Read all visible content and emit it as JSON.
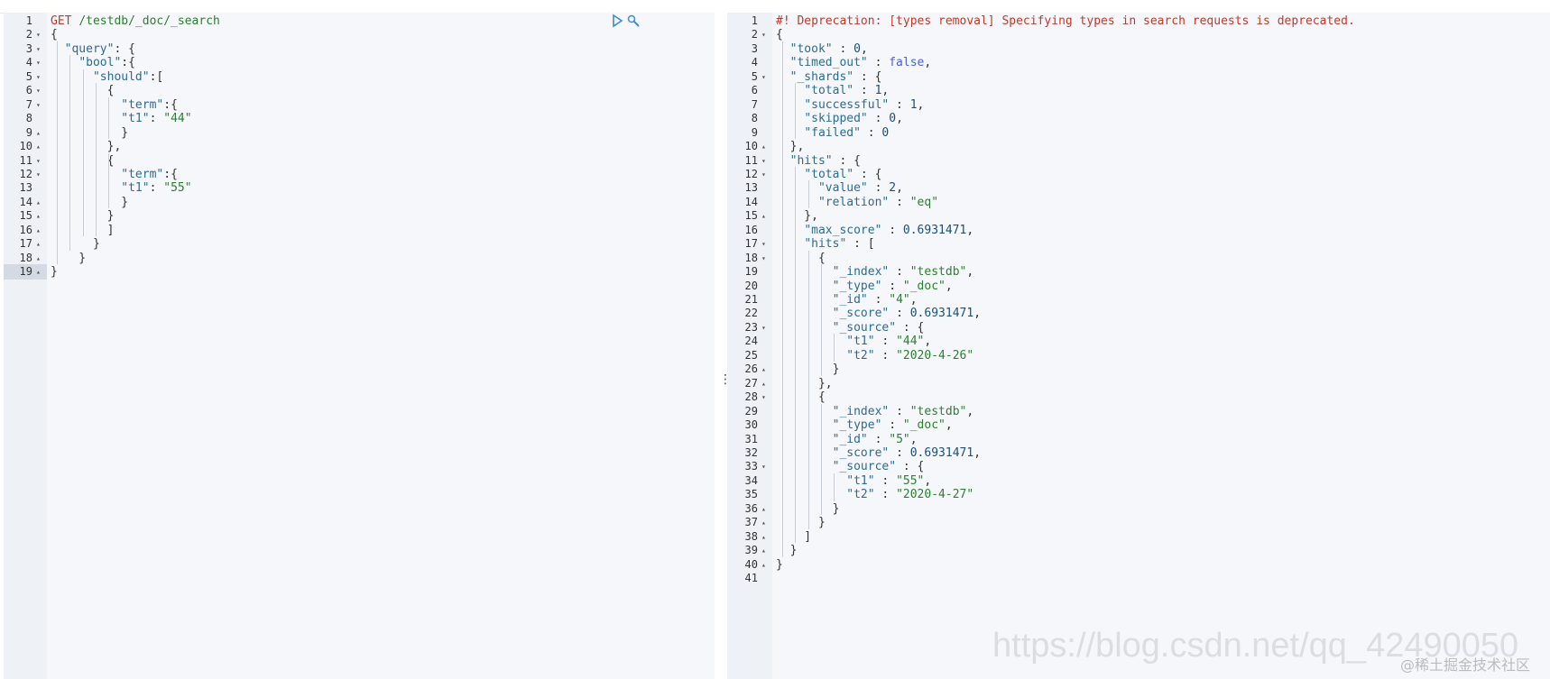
{
  "header": {
    "title": ""
  },
  "left_editor": {
    "lines": [
      [
        [
          "m",
          "GET"
        ],
        [
          "p",
          " "
        ],
        [
          "u",
          "/testdb/_doc/_search"
        ]
      ],
      [
        [
          "p",
          "{"
        ]
      ],
      [
        [
          "p",
          "  "
        ],
        [
          "k",
          "\"query\""
        ],
        [
          "p",
          ": {"
        ]
      ],
      [
        [
          "p",
          "    "
        ],
        [
          "k",
          "\"bool\""
        ],
        [
          "p",
          ":{"
        ]
      ],
      [
        [
          "p",
          "      "
        ],
        [
          "k",
          "\"should\""
        ],
        [
          "p",
          ":["
        ]
      ],
      [
        [
          "p",
          "        {"
        ]
      ],
      [
        [
          "p",
          "          "
        ],
        [
          "k",
          "\"term\""
        ],
        [
          "p",
          ":{"
        ]
      ],
      [
        [
          "p",
          "          "
        ],
        [
          "k",
          "\"t1\""
        ],
        [
          "p",
          ": "
        ],
        [
          "s",
          "\"44\""
        ]
      ],
      [
        [
          "p",
          "          }"
        ]
      ],
      [
        [
          "p",
          "        },"
        ]
      ],
      [
        [
          "p",
          "        {"
        ]
      ],
      [
        [
          "p",
          "          "
        ],
        [
          "k",
          "\"term\""
        ],
        [
          "p",
          ":{"
        ]
      ],
      [
        [
          "p",
          "          "
        ],
        [
          "k",
          "\"t1\""
        ],
        [
          "p",
          ": "
        ],
        [
          "s",
          "\"55\""
        ]
      ],
      [
        [
          "p",
          "          }"
        ]
      ],
      [
        [
          "p",
          "        }"
        ]
      ],
      [
        [
          "p",
          "        ]"
        ]
      ],
      [
        [
          "p",
          "      }"
        ]
      ],
      [
        [
          "p",
          "    }"
        ]
      ],
      [
        [
          "p",
          "}"
        ]
      ]
    ],
    "folds": [
      "",
      "▾",
      "▾",
      "▾",
      "▾",
      "▾",
      "▾",
      "",
      "▴",
      "▴",
      "▾",
      "▾",
      "",
      "▴",
      "▴",
      "▴",
      "▴",
      "▴",
      "▴"
    ],
    "active_line": 19,
    "play_icon": "play-icon",
    "wrench_icon": "wrench-icon"
  },
  "right_editor": {
    "lines": [
      [
        [
          "c",
          "#! Deprecation: [types removal] Specifying types in search requests is deprecated."
        ]
      ],
      [
        [
          "p",
          "{"
        ]
      ],
      [
        [
          "p",
          "  "
        ],
        [
          "k",
          "\"took\""
        ],
        [
          "p",
          " : "
        ],
        [
          "n",
          "0"
        ],
        [
          "p",
          ","
        ]
      ],
      [
        [
          "p",
          "  "
        ],
        [
          "k",
          "\"timed_out\""
        ],
        [
          "p",
          " : "
        ],
        [
          "b",
          "false"
        ],
        [
          "p",
          ","
        ]
      ],
      [
        [
          "p",
          "  "
        ],
        [
          "k",
          "\"_shards\""
        ],
        [
          "p",
          " : {"
        ]
      ],
      [
        [
          "p",
          "    "
        ],
        [
          "k",
          "\"total\""
        ],
        [
          "p",
          " : "
        ],
        [
          "n",
          "1"
        ],
        [
          "p",
          ","
        ]
      ],
      [
        [
          "p",
          "    "
        ],
        [
          "k",
          "\"successful\""
        ],
        [
          "p",
          " : "
        ],
        [
          "n",
          "1"
        ],
        [
          "p",
          ","
        ]
      ],
      [
        [
          "p",
          "    "
        ],
        [
          "k",
          "\"skipped\""
        ],
        [
          "p",
          " : "
        ],
        [
          "n",
          "0"
        ],
        [
          "p",
          ","
        ]
      ],
      [
        [
          "p",
          "    "
        ],
        [
          "k",
          "\"failed\""
        ],
        [
          "p",
          " : "
        ],
        [
          "n",
          "0"
        ]
      ],
      [
        [
          "p",
          "  },"
        ]
      ],
      [
        [
          "p",
          "  "
        ],
        [
          "k",
          "\"hits\""
        ],
        [
          "p",
          " : {"
        ]
      ],
      [
        [
          "p",
          "    "
        ],
        [
          "k",
          "\"total\""
        ],
        [
          "p",
          " : {"
        ]
      ],
      [
        [
          "p",
          "      "
        ],
        [
          "k",
          "\"value\""
        ],
        [
          "p",
          " : "
        ],
        [
          "n",
          "2"
        ],
        [
          "p",
          ","
        ]
      ],
      [
        [
          "p",
          "      "
        ],
        [
          "k",
          "\"relation\""
        ],
        [
          "p",
          " : "
        ],
        [
          "s",
          "\"eq\""
        ]
      ],
      [
        [
          "p",
          "    },"
        ]
      ],
      [
        [
          "p",
          "    "
        ],
        [
          "k",
          "\"max_score\""
        ],
        [
          "p",
          " : "
        ],
        [
          "n",
          "0.6931471"
        ],
        [
          "p",
          ","
        ]
      ],
      [
        [
          "p",
          "    "
        ],
        [
          "k",
          "\"hits\""
        ],
        [
          "p",
          " : ["
        ]
      ],
      [
        [
          "p",
          "      {"
        ]
      ],
      [
        [
          "p",
          "        "
        ],
        [
          "k",
          "\"_index\""
        ],
        [
          "p",
          " : "
        ],
        [
          "s",
          "\"testdb\""
        ],
        [
          "p",
          ","
        ]
      ],
      [
        [
          "p",
          "        "
        ],
        [
          "k",
          "\"_type\""
        ],
        [
          "p",
          " : "
        ],
        [
          "s",
          "\"_doc\""
        ],
        [
          "p",
          ","
        ]
      ],
      [
        [
          "p",
          "        "
        ],
        [
          "k",
          "\"_id\""
        ],
        [
          "p",
          " : "
        ],
        [
          "s",
          "\"4\""
        ],
        [
          "p",
          ","
        ]
      ],
      [
        [
          "p",
          "        "
        ],
        [
          "k",
          "\"_score\""
        ],
        [
          "p",
          " : "
        ],
        [
          "n",
          "0.6931471"
        ],
        [
          "p",
          ","
        ]
      ],
      [
        [
          "p",
          "        "
        ],
        [
          "k",
          "\"_source\""
        ],
        [
          "p",
          " : {"
        ]
      ],
      [
        [
          "p",
          "          "
        ],
        [
          "k",
          "\"t1\""
        ],
        [
          "p",
          " : "
        ],
        [
          "s",
          "\"44\""
        ],
        [
          "p",
          ","
        ]
      ],
      [
        [
          "p",
          "          "
        ],
        [
          "k",
          "\"t2\""
        ],
        [
          "p",
          " : "
        ],
        [
          "s",
          "\"2020-4-26\""
        ]
      ],
      [
        [
          "p",
          "        }"
        ]
      ],
      [
        [
          "p",
          "      },"
        ]
      ],
      [
        [
          "p",
          "      {"
        ]
      ],
      [
        [
          "p",
          "        "
        ],
        [
          "k",
          "\"_index\""
        ],
        [
          "p",
          " : "
        ],
        [
          "s",
          "\"testdb\""
        ],
        [
          "p",
          ","
        ]
      ],
      [
        [
          "p",
          "        "
        ],
        [
          "k",
          "\"_type\""
        ],
        [
          "p",
          " : "
        ],
        [
          "s",
          "\"_doc\""
        ],
        [
          "p",
          ","
        ]
      ],
      [
        [
          "p",
          "        "
        ],
        [
          "k",
          "\"_id\""
        ],
        [
          "p",
          " : "
        ],
        [
          "s",
          "\"5\""
        ],
        [
          "p",
          ","
        ]
      ],
      [
        [
          "p",
          "        "
        ],
        [
          "k",
          "\"_score\""
        ],
        [
          "p",
          " : "
        ],
        [
          "n",
          "0.6931471"
        ],
        [
          "p",
          ","
        ]
      ],
      [
        [
          "p",
          "        "
        ],
        [
          "k",
          "\"_source\""
        ],
        [
          "p",
          " : {"
        ]
      ],
      [
        [
          "p",
          "          "
        ],
        [
          "k",
          "\"t1\""
        ],
        [
          "p",
          " : "
        ],
        [
          "s",
          "\"55\""
        ],
        [
          "p",
          ","
        ]
      ],
      [
        [
          "p",
          "          "
        ],
        [
          "k",
          "\"t2\""
        ],
        [
          "p",
          " : "
        ],
        [
          "s",
          "\"2020-4-27\""
        ]
      ],
      [
        [
          "p",
          "        }"
        ]
      ],
      [
        [
          "p",
          "      }"
        ]
      ],
      [
        [
          "p",
          "    ]"
        ]
      ],
      [
        [
          "p",
          "  }"
        ]
      ],
      [
        [
          "p",
          "}"
        ]
      ],
      [
        [
          "p",
          ""
        ]
      ]
    ],
    "folds": [
      "",
      "▾",
      "",
      "",
      "▾",
      "",
      "",
      "",
      "",
      "▴",
      "▾",
      "▾",
      "",
      "",
      "▴",
      "",
      "▾",
      "▾",
      "",
      "",
      "",
      "",
      "▾",
      "",
      "",
      "▴",
      "▴",
      "▾",
      "",
      "",
      "",
      "",
      "▾",
      "",
      "",
      "▴",
      "▴",
      "▴",
      "▴",
      "▴",
      ""
    ],
    "active_line": 1
  },
  "splitter": {
    "handle": "⋮"
  },
  "watermark": {
    "url": "https://blog.csdn.net/qq_42490050",
    "site": "@稀土掘金技术社区"
  },
  "colors": {
    "key": "#2f6a90",
    "string": "#2e7d32",
    "number": "#1a4f7a",
    "boolean": "#4a60d8",
    "method": "#c0392b",
    "comment": "#c0392b",
    "active_row": "#dce2ea",
    "editor_bg": "#f5f7fa"
  }
}
